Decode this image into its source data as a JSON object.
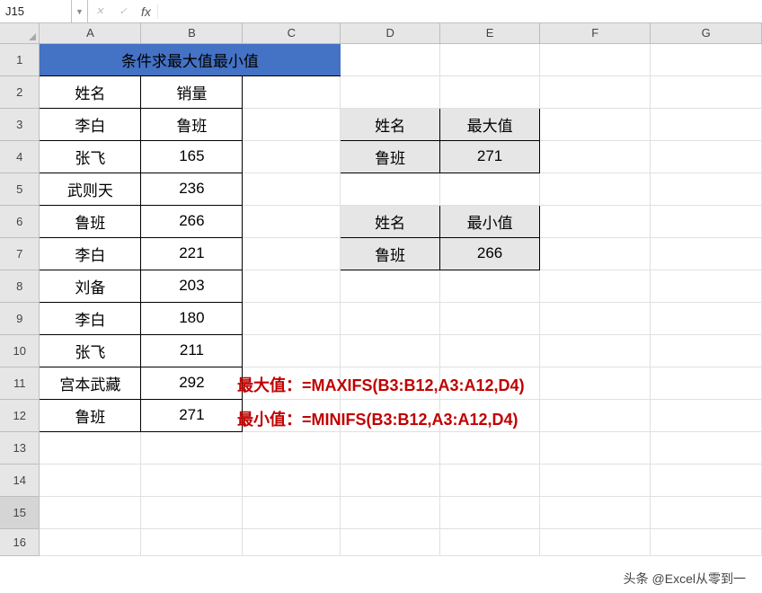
{
  "formulaBar": {
    "nameBox": "J15",
    "fxLabel": "fx",
    "inputValue": ""
  },
  "columns": [
    "A",
    "B",
    "C",
    "D",
    "E",
    "F",
    "G"
  ],
  "rows": [
    "1",
    "2",
    "3",
    "4",
    "5",
    "6",
    "7",
    "8",
    "9",
    "10",
    "11",
    "12",
    "13",
    "14",
    "15",
    "16"
  ],
  "title": "条件求最大值最小值",
  "tableMain": {
    "headers": {
      "name": "姓名",
      "sales": "销量"
    },
    "rows": [
      {
        "name": "李白",
        "sales": "鲁班"
      },
      {
        "name": "张飞",
        "sales": "165"
      },
      {
        "name": "武则天",
        "sales": "236"
      },
      {
        "name": "鲁班",
        "sales": "266"
      },
      {
        "name": "李白",
        "sales": "221"
      },
      {
        "name": "刘备",
        "sales": "203"
      },
      {
        "name": "李白",
        "sales": "180"
      },
      {
        "name": "张飞",
        "sales": "211"
      },
      {
        "name": "宫本武藏",
        "sales": "292"
      },
      {
        "name": "鲁班",
        "sales": "271"
      }
    ]
  },
  "lookupMax": {
    "hName": "姓名",
    "hVal": "最大值",
    "name": "鲁班",
    "val": "271"
  },
  "lookupMin": {
    "hName": "姓名",
    "hVal": "最小值",
    "name": "鲁班",
    "val": "266"
  },
  "formulas": {
    "max": "最大值：=MAXIFS(B3:B12,A3:A12,D4)",
    "min": "最小值：=MINIFS(B3:B12,A3:A12,D4)"
  },
  "watermark": "头条 @Excel从零到一",
  "activeCell": "J15"
}
